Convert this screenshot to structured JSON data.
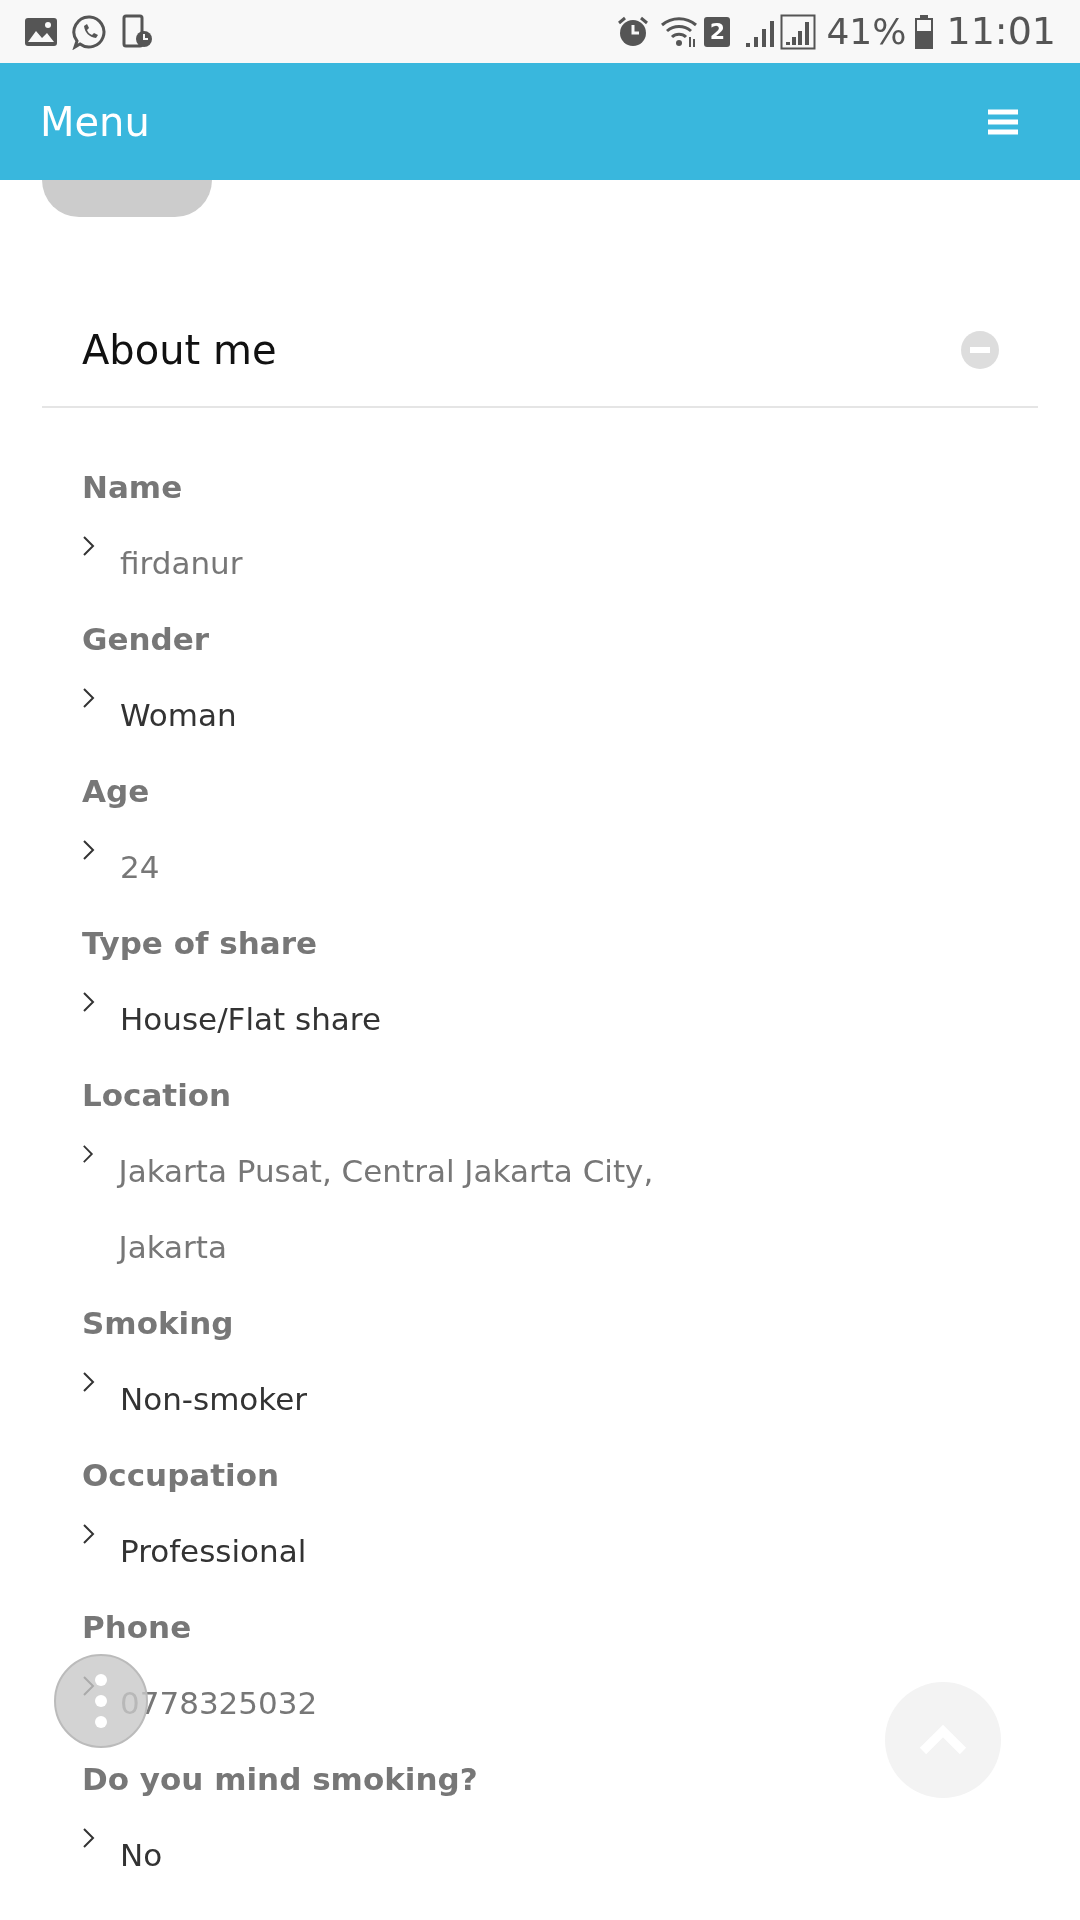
{
  "status_bar": {
    "sim_slot": "2",
    "battery": "41%",
    "time": "11:01"
  },
  "header": {
    "title": "Menu"
  },
  "profile_actions": [
    {
      "kind": "primary"
    }
  ],
  "section": {
    "title": "About me",
    "expanded": true
  },
  "fields": [
    {
      "label": "Name",
      "value": "firdanur",
      "kind": "text"
    },
    {
      "label": "Gender",
      "value": "Woman",
      "kind": "choice"
    },
    {
      "label": "Age",
      "value": "24",
      "kind": "text"
    },
    {
      "label": "Type of share",
      "value": "House/Flat share",
      "kind": "choice"
    },
    {
      "label": "Location",
      "value": "Jakarta Pusat, Central Jakarta City, Jakarta",
      "kind": "text"
    },
    {
      "label": "Smoking",
      "value": "Non-smoker",
      "kind": "choice"
    },
    {
      "label": "Occupation",
      "value": "Professional",
      "kind": "choice"
    },
    {
      "label": "Phone",
      "value": "0778325032",
      "kind": "text"
    },
    {
      "label": "Do you mind smoking?",
      "value": "No",
      "kind": "choice"
    }
  ]
}
